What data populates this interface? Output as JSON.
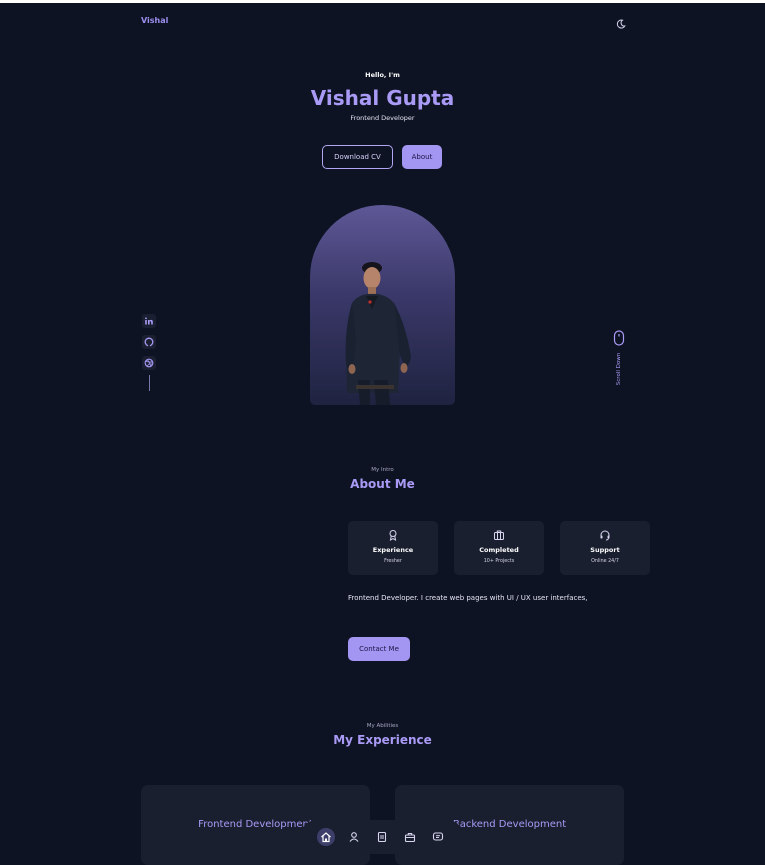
{
  "header": {
    "brand": "Vishal",
    "theme_toggle_icon": "moon-icon"
  },
  "hero": {
    "greeting": "Hello, I'm",
    "name": "Vishal Gupta",
    "role": "Frontend Developer",
    "download_cv_label": "Download CV",
    "about_label": "About",
    "photo_icon": "person-photo",
    "scroll_label": "Scroll Down"
  },
  "social": {
    "items": [
      "linkedin-icon",
      "github-icon",
      "dribbble-icon"
    ]
  },
  "about": {
    "subtitle": "My Intro",
    "title": "About Me",
    "cards": [
      {
        "title": "Experience",
        "sub": "Fresher",
        "icon": "award-icon"
      },
      {
        "title": "Completed",
        "sub": "10+ Projects",
        "icon": "briefcase-icon"
      },
      {
        "title": "Support",
        "sub": "Online 24/7",
        "icon": "headset-icon"
      }
    ],
    "description": "Frontend Developer. I create web pages with UI / UX user interfaces,",
    "contact_label": "Contact Me"
  },
  "experience": {
    "subtitle": "My Abilities",
    "title": "My Experience",
    "cards": [
      {
        "title": "Frontend Development"
      },
      {
        "title": "Backend Development"
      }
    ]
  },
  "nav": {
    "items": [
      "home-icon",
      "user-icon",
      "file-icon",
      "briefcase-icon",
      "message-icon"
    ],
    "active_index": 0
  },
  "colors": {
    "background": "#0d1322",
    "accent": "#a99af6",
    "card": "#1a1f2f"
  }
}
